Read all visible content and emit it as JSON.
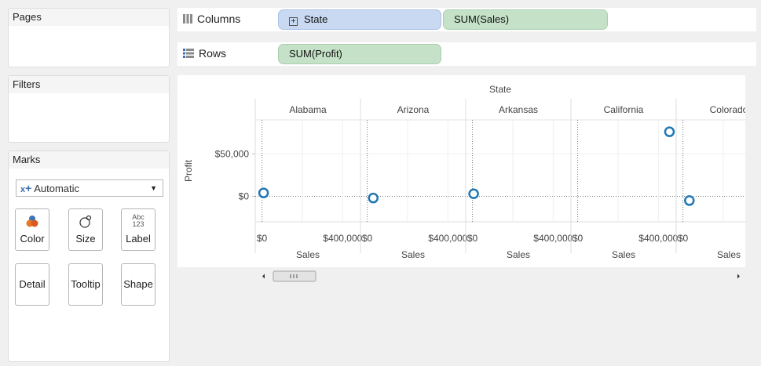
{
  "cards": {
    "pages": {
      "title": "Pages"
    },
    "filters": {
      "title": "Filters"
    },
    "marks": {
      "title": "Marks",
      "mark_type": "Automatic",
      "buttons": {
        "color": "Color",
        "size": "Size",
        "label": "Label",
        "detail": "Detail",
        "tooltip": "Tooltip",
        "shape": "Shape"
      },
      "label_icon_text": [
        "Abc",
        "123"
      ]
    }
  },
  "shelves": {
    "columns": {
      "label": "Columns",
      "pills": [
        "State",
        "SUM(Sales)"
      ]
    },
    "rows": {
      "label": "Rows",
      "pills": [
        "SUM(Profit)"
      ]
    }
  },
  "chart_data": {
    "type": "scatter",
    "title": "State",
    "ylabel": "Profit",
    "xlabel": "Sales",
    "y_ticks": [
      "$50,000",
      "$0"
    ],
    "x_ticks": [
      "$0",
      "$400,000"
    ],
    "panels": [
      {
        "state": "Alabama",
        "x": 8000,
        "y": 4000
      },
      {
        "state": "Arizona",
        "x": 30000,
        "y": -2000
      },
      {
        "state": "Arkansas",
        "x": 6000,
        "y": 3000
      },
      {
        "state": "California",
        "x": 455000,
        "y": 76000
      },
      {
        "state": "Colorado",
        "x": 32000,
        "y": -5000
      }
    ],
    "x_per_panel_range": [
      -10000,
      465000
    ],
    "ylim": [
      -30000,
      90000
    ],
    "last_panel_clipped": true,
    "mark_shape": "open circle",
    "mark_color": "#1f77b4"
  }
}
